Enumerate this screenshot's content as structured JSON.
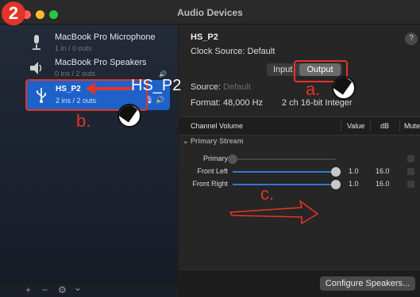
{
  "step_number": "2",
  "window": {
    "title": "Audio Devices"
  },
  "sidebar": {
    "devices": [
      {
        "name": "MacBook Pro Microphone",
        "sub": "1 in / 0 outs"
      },
      {
        "name": "MacBook Pro Speakers",
        "sub": "0 ins / 2 outs"
      },
      {
        "name": "HS_P2",
        "sub": "2 ins / 2 outs"
      }
    ],
    "bottom": {
      "add": "+",
      "remove": "−",
      "gear": "⚙",
      "chevron": "⌄"
    }
  },
  "main": {
    "device_title": "HS_P2",
    "clock_source": "Clock Source:  Default",
    "help": "?",
    "tabs": {
      "input": "Input",
      "output": "Output"
    },
    "source_label": "Source:",
    "source_value": "Default",
    "format_label": "Format:  48,000 Hz",
    "format_value": "2 ch 16-bit Integer",
    "table_headers": {
      "channel": "Channel Volume",
      "value": "Value",
      "db": "dB",
      "mute": "Mute"
    },
    "stream_header": "⌄ Primary Stream",
    "channels": [
      {
        "label": "Primary",
        "level": 0.0,
        "value": "",
        "db": ""
      },
      {
        "label": "Front Left",
        "level": 1.0,
        "value": "1.0",
        "db": "16.0"
      },
      {
        "label": "Front Right",
        "level": 1.0,
        "value": "1.0",
        "db": "16.0"
      }
    ],
    "configure_button": "Configure Speakers..."
  },
  "annotations": {
    "hs_label": "HS_P2",
    "a": "a.",
    "b": "b.",
    "c": "c."
  },
  "colors": {
    "accent": "#1e62c9",
    "annotation": "#e4342a"
  }
}
